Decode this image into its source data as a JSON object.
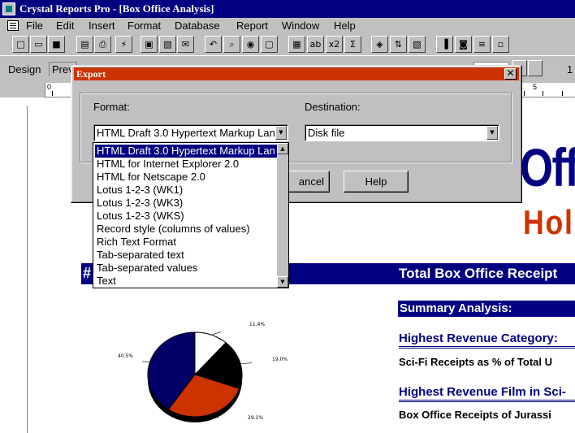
{
  "window": {
    "title": "Crystal Reports Pro - [Box Office Analysis]"
  },
  "menu": [
    "File",
    "Edit",
    "Insert",
    "Format",
    "Database",
    "Report",
    "Window",
    "Help"
  ],
  "toolbar": {
    "buttons": [
      "new",
      "open",
      "save",
      "print-preview",
      "print",
      "refresh",
      "snapshot",
      "export",
      "mail",
      "undo",
      "search",
      "find",
      "zoom",
      "database",
      "text-field",
      "formula",
      "sum",
      "group-expert",
      "sort",
      "select",
      "chart",
      "picture",
      "line",
      "box"
    ],
    "glyphs": [
      "□",
      "▭",
      "■",
      "▤",
      "⎙",
      "⚡",
      "▣",
      "▨",
      "✉",
      "↶",
      "⌕",
      "◉",
      "▢",
      "▦",
      "ab",
      "x2",
      "Σ",
      "◈",
      "⇅",
      "▧",
      "▐",
      "◙",
      "≡",
      "▫"
    ]
  },
  "tabs": {
    "design": "Design",
    "preview": "Prev"
  },
  "page_number": "1",
  "ruler": {
    "mark_left": "0",
    "mark_right": "5"
  },
  "report": {
    "title_fragment": "Off",
    "subtitle_fragment": "Hol",
    "band_hash": "#",
    "band_title": "Total Box Office Receipt",
    "summary": "Summary Analysis:",
    "highest_category_heading": "Highest Revenue Category:",
    "highest_category_line": "Sci-Fi Receipts as % of Total U",
    "highest_film_heading": "Highest Revenue Film in Sci-",
    "highest_film_line": "Box Office Receipts of Jurassi"
  },
  "chart_data": {
    "type": "pie",
    "values": [
      11.4,
      19.0,
      29.1,
      40.5
    ],
    "labels": [
      "11.4%",
      "19.0%",
      "29.1%",
      "40.5%"
    ],
    "colors": [
      "#ffffff",
      "#000000",
      "#cc3300",
      "#000066"
    ]
  },
  "dialog": {
    "title": "Export",
    "close_glyph": "✕",
    "format_label": "Format:",
    "destination_label": "Destination:",
    "format_value": "HTML Draft 3.0 Hypertext Markup Lan",
    "destination_value": "Disk file",
    "cancel_label": "ancel",
    "help_label": "Help",
    "dropdown_arrow": "▼",
    "scroll_up": "▲",
    "scroll_down": "▼"
  },
  "format_options": [
    "HTML Draft 3.0 Hypertext Markup Lan",
    "HTML for Internet Explorer 2.0",
    "HTML for Netscape 2.0",
    "Lotus 1-2-3 (WK1)",
    "Lotus 1-2-3 (WK3)",
    "Lotus 1-2-3 (WKS)",
    "Record style (columns of values)",
    "Rich Text Format",
    "Tab-separated text",
    "Tab-separated values",
    "Text"
  ]
}
